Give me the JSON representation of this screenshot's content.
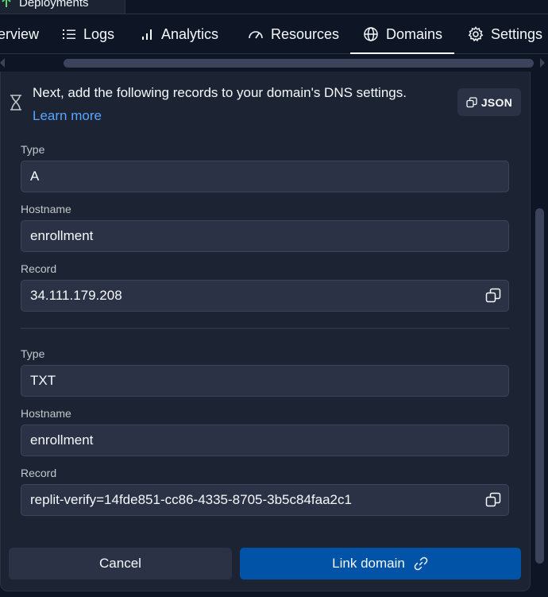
{
  "top_tab": {
    "label": "Deployments"
  },
  "nav": {
    "tabs": [
      {
        "label": "erview",
        "icon": "overview-icon"
      },
      {
        "label": "Logs",
        "icon": "list-icon"
      },
      {
        "label": "Analytics",
        "icon": "bar-chart-icon"
      },
      {
        "label": "Resources",
        "icon": "gauge-icon"
      },
      {
        "label": "Domains",
        "icon": "globe-icon",
        "active": true
      },
      {
        "label": "Settings",
        "icon": "gear-icon"
      }
    ]
  },
  "notice": {
    "message": "Next, add the following records to your domain's DNS settings.",
    "learn_more": "Learn more"
  },
  "json_button": {
    "label": "JSON"
  },
  "records": [
    {
      "type_label": "Type",
      "type": "A",
      "hostname_label": "Hostname",
      "hostname": "enrollment",
      "record_label": "Record",
      "record": "34.111.179.208"
    },
    {
      "type_label": "Type",
      "type": "TXT",
      "hostname_label": "Hostname",
      "hostname": "enrollment",
      "record_label": "Record",
      "record": "replit-verify=14fde851-cc86-4335-8705-3b5c84faa2c1"
    }
  ],
  "actions": {
    "cancel": "Cancel",
    "link_domain": "Link domain"
  },
  "colors": {
    "background": "#0e1525",
    "panel": "#1c2333",
    "field": "#2b3245",
    "link": "#58a6ff",
    "primary_button": "#0053a6",
    "deploy_accent": "#5bd96b"
  }
}
